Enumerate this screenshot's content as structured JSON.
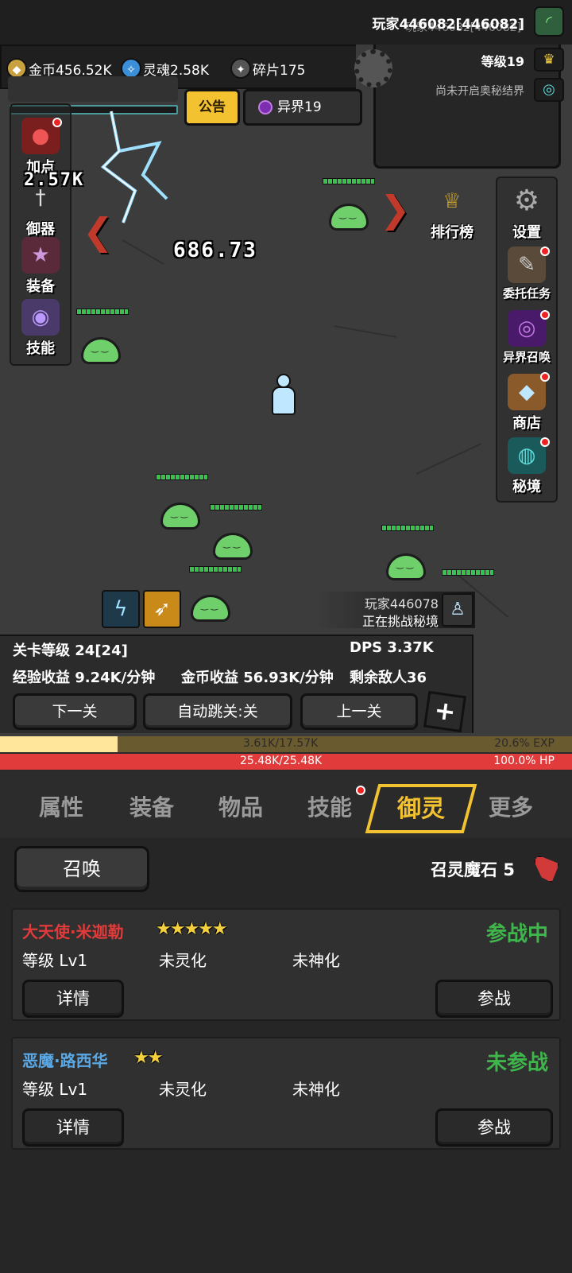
{
  "status_bar": {
    "text": "玩家446082[446082]"
  },
  "resources": {
    "gold": "金币456.52K",
    "soul": "灵魂2.58K",
    "fragment": "碎片175"
  },
  "player": {
    "name": "玩家446082[446082]",
    "level": "等级19",
    "realm_status": "尚未开启奥秘结界"
  },
  "top_buttons": {
    "notice": "公告",
    "otherworld": "异界19"
  },
  "left_menu": [
    "加点",
    "御器",
    "装备",
    "技能"
  ],
  "right_menu": [
    "排行榜",
    "设置",
    "委托任务",
    "异界召唤",
    "商店",
    "秘境"
  ],
  "battle": {
    "damage_numbers": [
      "686.73",
      "2.57K"
    ]
  },
  "challenge_notice": {
    "player": "玩家446078",
    "message": "正在挑战秘境"
  },
  "stage_stats": {
    "stage_level": "关卡等级 24[24]",
    "dps": "DPS  3.37K",
    "exp_income": "经验收益 9.24K/分钟",
    "gold_income": "金币收益 56.93K/分钟",
    "enemies_left": "剩余敌人36"
  },
  "stage_buttons": {
    "next": "下一关",
    "auto_skip": "自动跳关:关",
    "prev": "上一关"
  },
  "exp_bar": {
    "text": "3.61K/17.57K",
    "percent_text": "20.6%  EXP",
    "fraction": 0.206
  },
  "hp_bar": {
    "text": "25.48K/25.48K",
    "percent_text": "100.0%   HP",
    "fraction": 1.0
  },
  "tabs": [
    "属性",
    "装备",
    "物品",
    "技能",
    "御灵",
    "更多"
  ],
  "active_tab": "御灵",
  "summon": {
    "button": "召唤",
    "stone_label": "召灵魔石 5"
  },
  "spirits": [
    {
      "name": "大天使·米迦勒",
      "name_color": "#e23b3b",
      "stars": "★★★★★",
      "status": "参战中",
      "level": "等级 Lv1",
      "spirit_state": "未灵化",
      "divine_state": "未神化",
      "detail_btn": "详情",
      "battle_btn": "参战"
    },
    {
      "name": "恶魔·路西华",
      "name_color": "#5aa9e6",
      "stars": "★★",
      "status": "未参战",
      "level": "等级 Lv1",
      "spirit_state": "未灵化",
      "divine_state": "未神化",
      "detail_btn": "详情",
      "battle_btn": "参战"
    }
  ],
  "colors": {
    "accent": "#f2c230",
    "exp": "#ffe69a",
    "hp": "#e13b3b",
    "status_green": "#3fb64b"
  }
}
